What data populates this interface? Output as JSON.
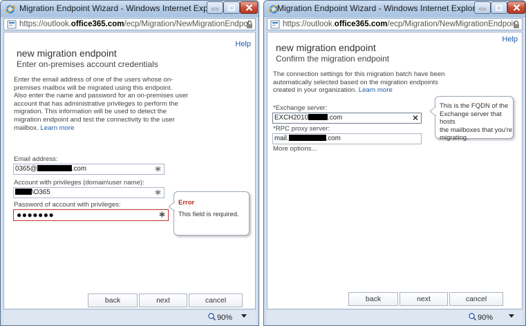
{
  "windows": [
    {
      "title": "Migration Endpoint Wizard - Windows Internet Explorer",
      "url_prefix": "https://outlook.",
      "url_domain": "office365.com",
      "url_path": "/ecp/Migration/NewMigrationEndpoint.aspx?re",
      "help": "Help",
      "heading": "new migration endpoint",
      "subheading": "Enter on-premises account credentials",
      "description_lines": [
        "Enter the email address of one of the users whose on-",
        "premises mailbox will be migrated using this endpoint.",
        "Also enter the name and password for an on-premises user",
        "account that has administrative privileges to perform the",
        "migration. This information will be used to detect the",
        "migration endpoint and test the connectivity to the user"
      ],
      "description_last_prefix": "mailbox.",
      "learn_more": "Learn more",
      "fields": {
        "email_label": "Email address:",
        "email_value_prefix": "0365@",
        "email_value_suffix": ".com",
        "account_label": "Account with privileges (domain\\user name):",
        "account_value_suffix": "\\O365",
        "password_label": "Password of account with privileges:",
        "password_value": "●●●●●●●"
      },
      "error_callout": {
        "title": "Error",
        "message": "This field is required."
      },
      "buttons": {
        "back": "back",
        "next": "next",
        "cancel": "cancel"
      },
      "zoom": "90%"
    },
    {
      "title": "Migration Endpoint Wizard - Windows Internet Explorer",
      "url_prefix": "https://outlook.",
      "url_domain": "office365.com",
      "url_path": "/ecp/Migration/NewMigrationEndpoint.aspx?re",
      "help": "Help",
      "heading": "new migration endpoint",
      "subheading": "Confirm the migration endpoint",
      "description_lines": [
        "The connection settings for this migration batch have been",
        "automatically selected based on the migration endpoints"
      ],
      "description_last_prefix": "created in your organization.",
      "learn_more": "Learn more",
      "fields": {
        "exchange_label": "*Exchange server:",
        "exchange_value_prefix": "EXCH2010",
        "exchange_value_suffix": ".com",
        "rpc_label": "*RPC proxy server:",
        "rpc_value_prefix": "mail.",
        "rpc_value_suffix": ".com",
        "more_options": "More options..."
      },
      "tip_callout": {
        "lines": [
          "This is the FQDN of the",
          "Exchange server that hosts",
          "the mailboxes that you're",
          "migrating."
        ]
      },
      "buttons": {
        "back": "back",
        "next": "next",
        "cancel": "cancel"
      },
      "zoom": "90%"
    }
  ],
  "colors": {
    "link": "#1f5aa6",
    "error": "#c4312b",
    "window_frame": "#d3e0ef"
  },
  "icons": [
    "ie-icon",
    "page-icon",
    "lock-icon",
    "minimize-icon",
    "maximize-icon",
    "close-icon",
    "required-star-icon",
    "clear-x-icon",
    "zoom-icon",
    "chevron-down-icon"
  ]
}
